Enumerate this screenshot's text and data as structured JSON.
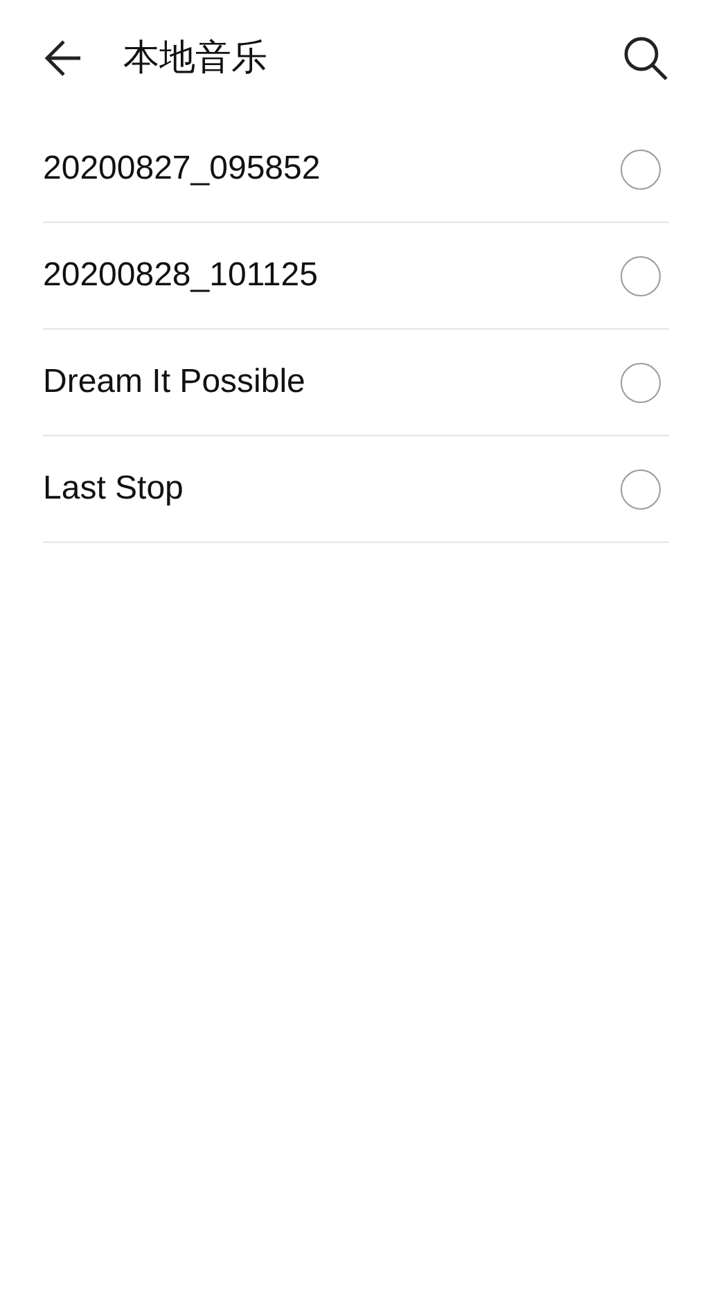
{
  "header": {
    "title": "本地音乐"
  },
  "songs": [
    {
      "title": "20200827_095852",
      "selected": false
    },
    {
      "title": "20200828_101125",
      "selected": false
    },
    {
      "title": "Dream It Possible",
      "selected": false
    },
    {
      "title": "Last Stop",
      "selected": false
    }
  ]
}
